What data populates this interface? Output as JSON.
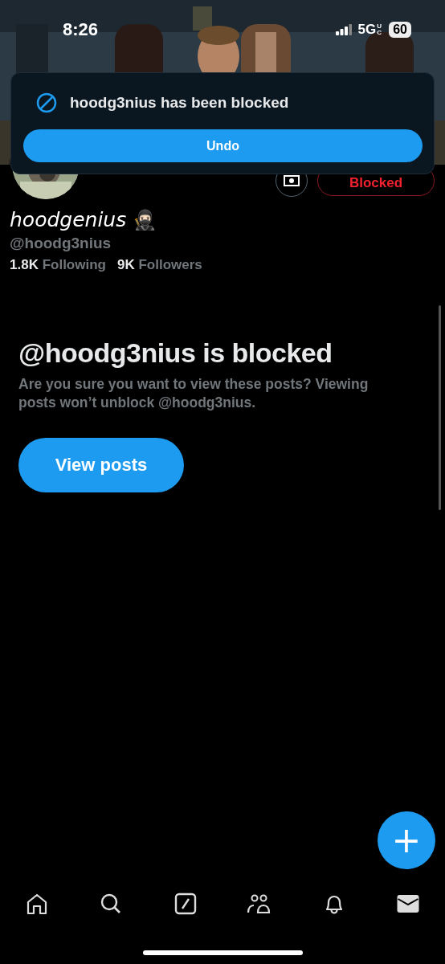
{
  "status_bar": {
    "time": "8:26",
    "network": "5G",
    "network_suffix": "UC",
    "battery": "60"
  },
  "toast": {
    "message": "hoodg3nius has been blocked",
    "action": "Undo"
  },
  "profile": {
    "display_name": "hoodgenius",
    "emoji": "🥷🏻",
    "handle": "@hoodg3nius",
    "following_count": "1.8K",
    "following_label": "Following",
    "followers_count": "9K",
    "followers_label": "Followers",
    "blocked_button": "Blocked"
  },
  "blocked_notice": {
    "title": "@hoodg3nius is blocked",
    "body": "Are you sure you want to view these posts? Viewing posts won’t unblock @hoodg3nius.",
    "button": "View posts"
  },
  "fab": {
    "label": "+"
  },
  "nav": [
    {
      "kind": "home",
      "selected": false
    },
    {
      "kind": "search",
      "selected": false
    },
    {
      "kind": "grok",
      "selected": false
    },
    {
      "kind": "communities",
      "selected": false
    },
    {
      "kind": "notifications",
      "selected": false
    },
    {
      "kind": "messages",
      "selected": true
    }
  ]
}
